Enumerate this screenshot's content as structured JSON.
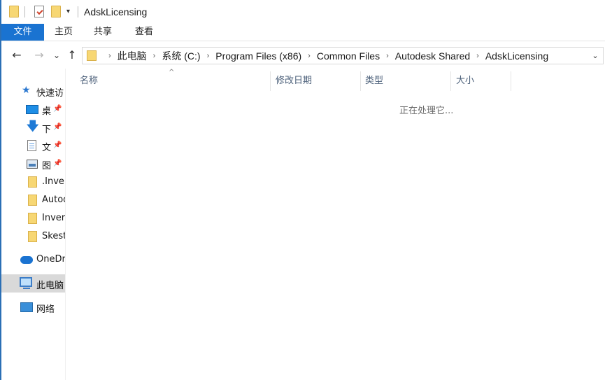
{
  "window": {
    "title": "AdskLicensing",
    "accent_color": "#1a73d1"
  },
  "quick_access_toolbar": {
    "icons": [
      "folder-icon",
      "properties-icon",
      "new-folder-icon",
      "customize-dropdown-icon"
    ]
  },
  "ribbon": {
    "tabs": [
      {
        "label": "文件",
        "active": true
      },
      {
        "label": "主页"
      },
      {
        "label": "共享"
      },
      {
        "label": "查看"
      }
    ]
  },
  "navigation": {
    "back_icon": "←",
    "forward_icon": "→",
    "recent_icon": "⌄",
    "up_icon": "↑"
  },
  "address_bar": {
    "crumbs": [
      "此电脑",
      "系统 (C:)",
      "Program Files (x86)",
      "Common Files",
      "Autodesk Shared",
      "AdskLicensing"
    ],
    "separator": "›",
    "dropdown_icon": "⌄"
  },
  "nav_pane": {
    "items": [
      {
        "label": "快速访",
        "icon": "star-icon"
      },
      {
        "label": "桌",
        "icon": "desktop-icon",
        "pinned": true
      },
      {
        "label": "下",
        "icon": "download-icon",
        "pinned": true
      },
      {
        "label": "文",
        "icon": "document-icon",
        "pinned": true
      },
      {
        "label": "图",
        "icon": "picture-icon",
        "pinned": true
      },
      {
        "label": ".Inver",
        "icon": "folder-icon"
      },
      {
        "label": "Autod",
        "icon": "folder-icon"
      },
      {
        "label": "Inver",
        "icon": "folder-icon"
      },
      {
        "label": "Skest",
        "icon": "folder-icon"
      },
      {
        "label": "OneDr",
        "icon": "cloud-icon"
      },
      {
        "label": "此电脑",
        "icon": "pc-icon",
        "selected": true
      },
      {
        "label": "网络",
        "icon": "network-icon"
      }
    ],
    "pin_glyph": "📌"
  },
  "file_list": {
    "columns": [
      "名称",
      "修改日期",
      "类型",
      "大小"
    ],
    "sort_indicator": "^",
    "status_text": "正在处理它..."
  }
}
